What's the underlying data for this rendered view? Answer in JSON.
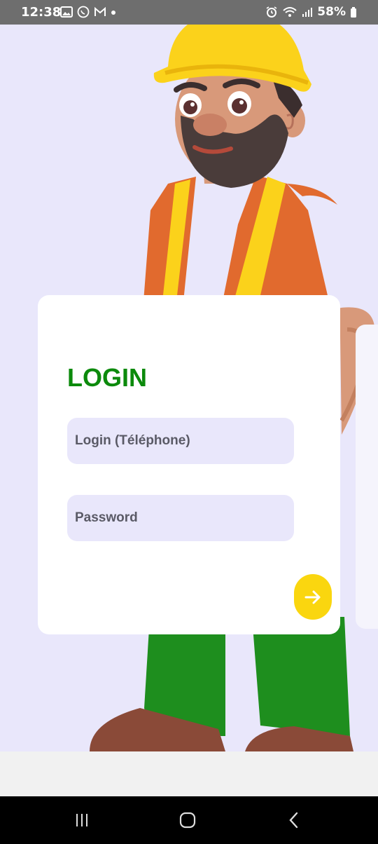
{
  "status_bar": {
    "time": "12:38",
    "battery": "58%",
    "left_icons": [
      "gallery-icon",
      "whatsapp-icon",
      "gmail-icon",
      "dot-icon"
    ],
    "right_icons": [
      "alarm-icon",
      "wifi-icon",
      "signal-icon",
      "battery-icon"
    ]
  },
  "login": {
    "title": "LOGIN",
    "login_placeholder": "Login (Téléphone)",
    "password_placeholder": "Password",
    "submit_icon": "arrow-right-icon"
  },
  "colors": {
    "background": "#e9e7fb",
    "title_green": "#0c8a0c",
    "field_bg": "#e9e7fb",
    "button_yellow": "#fad60f"
  },
  "navbar": {
    "icons": [
      "recent-apps-icon",
      "home-icon",
      "back-icon"
    ]
  }
}
